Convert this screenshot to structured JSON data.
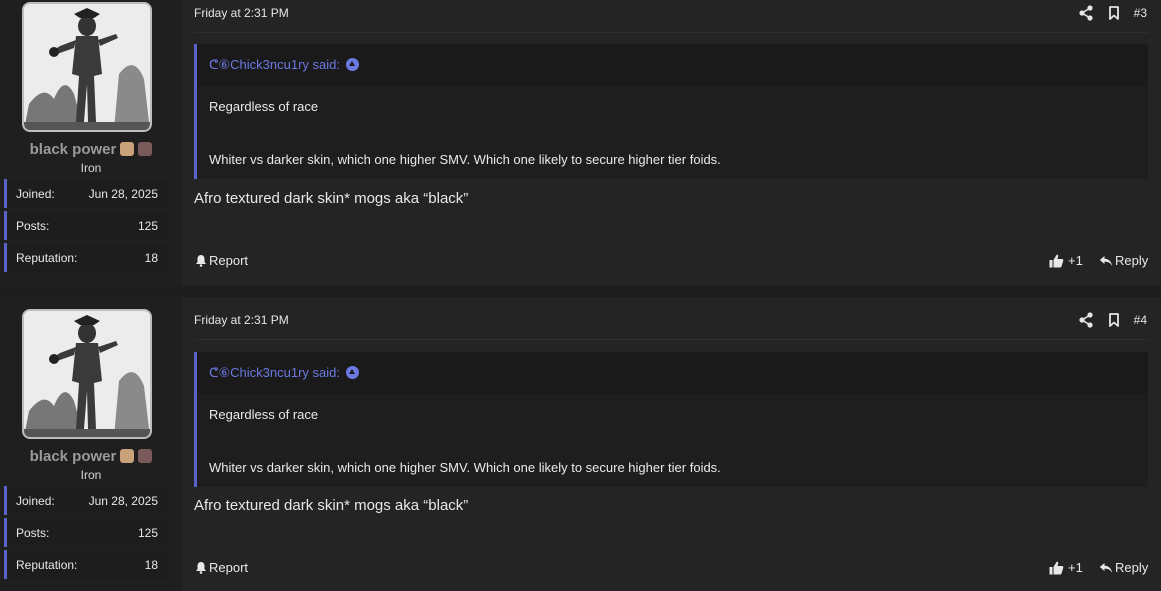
{
  "posts": [
    {
      "username": "black power",
      "rank": "Iron",
      "stats": [
        {
          "label": "Joined:",
          "value": "Jun 28, 2025"
        },
        {
          "label": "Posts:",
          "value": "125"
        },
        {
          "label": "Reputation:",
          "value": "18"
        }
      ],
      "timestamp": "Friday at 2:31 PM",
      "post_number": "#3",
      "quote": {
        "author": "ᕦ⑥Chick3ncu1ry said:",
        "line1": "Regardless of race",
        "line2": "Whiter vs darker skin, which one higher SMV. Which one likely to secure higher tier foids."
      },
      "message": "Afro textured dark skin* mogs aka “black”",
      "report_label": "Report",
      "reaction_count": "+1",
      "reply_label": "Reply"
    },
    {
      "username": "black power",
      "rank": "Iron",
      "stats": [
        {
          "label": "Joined:",
          "value": "Jun 28, 2025"
        },
        {
          "label": "Posts:",
          "value": "125"
        },
        {
          "label": "Reputation:",
          "value": "18"
        }
      ],
      "timestamp": "Friday at 2:31 PM",
      "post_number": "#4",
      "quote": {
        "author": "ᕦ⑥Chick3ncu1ry said:",
        "line1": "Regardless of race",
        "line2": "Whiter vs darker skin, which one higher SMV. Which one likely to secure higher tier foids."
      },
      "message": "Afro textured dark skin* mogs aka “black”",
      "report_label": "Report",
      "reaction_count": "+1",
      "reply_label": "Reply"
    }
  ],
  "colors": {
    "background": "#1d1d1d",
    "post_bg": "#242424",
    "accent": "#5a63c9",
    "quote_author": "#6b79e0"
  },
  "icons": [
    "share-icon",
    "bookmark-icon",
    "arrow-up-circle-icon",
    "bell-icon",
    "thumbs-up-icon",
    "reply-icon"
  ]
}
